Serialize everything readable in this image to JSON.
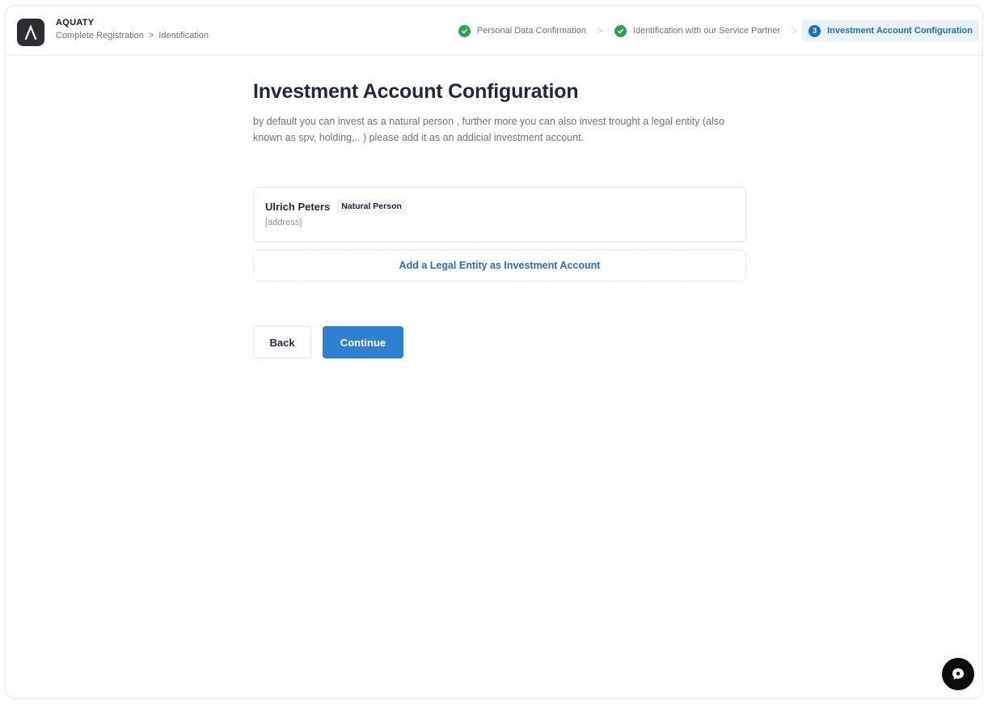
{
  "header": {
    "brand": "AQUATY",
    "breadcrumb": [
      "Complete Registration",
      ">",
      "Identification"
    ],
    "steps": [
      {
        "label": "Personal Data Confirmation",
        "status": "done"
      },
      {
        "label": "Identification with our Service Partner",
        "status": "done"
      },
      {
        "label": "Investment Account Configuration",
        "status": "active",
        "number": "3"
      }
    ],
    "step_separator": ">"
  },
  "main": {
    "title": "Investment Account Configuration",
    "description": "by default you can invest as a natural person , further more you can also invest trought a legal entity (also known as spv, holding,.. ) please add it as an addicial investment account.",
    "account": {
      "name": "Ulrich Peters",
      "badge": "Natural Person",
      "address": "[address]"
    },
    "add_legal_label": "Add a Legal Entity as Investment Account"
  },
  "actions": {
    "back_label": "Back",
    "continue_label": "Continue"
  },
  "colors": {
    "accent": "#2f80d1",
    "success": "#2e9e58",
    "active_step_bg": "#e8f2fb"
  },
  "icons": {
    "logo": "aquaty-logo-icon",
    "step_done": "check-circle-icon",
    "chat": "chat-bubble-icon"
  }
}
